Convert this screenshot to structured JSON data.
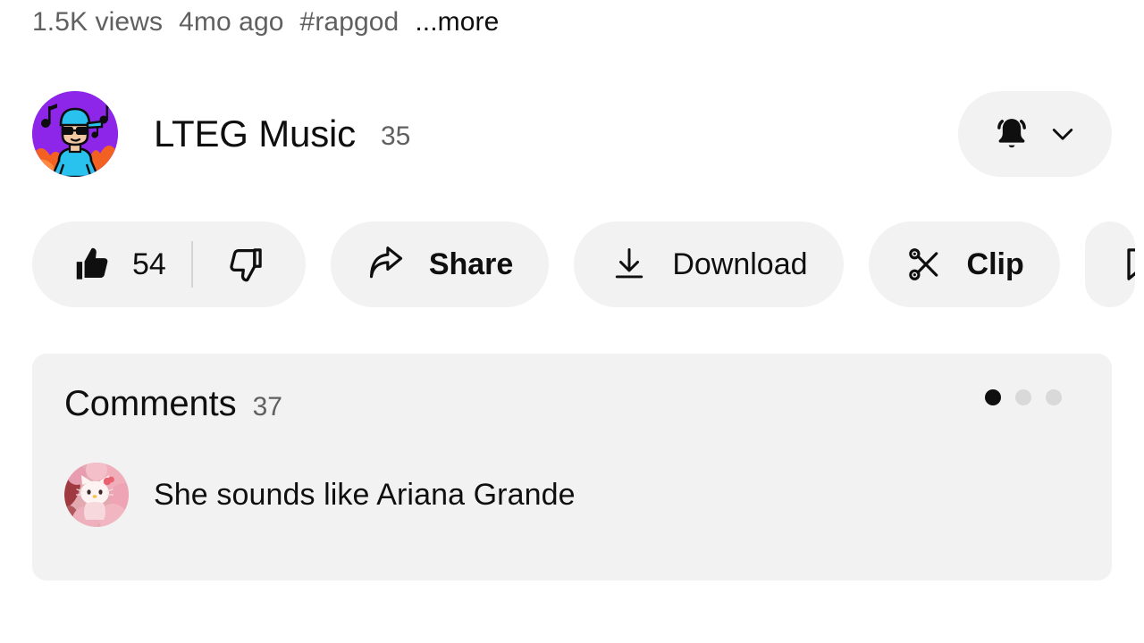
{
  "video_meta": {
    "views": "1.5K views",
    "published": "4mo ago",
    "hashtag": "#rapgod",
    "more_label": "...more"
  },
  "channel": {
    "name": "LTEG Music",
    "subscribers": "35",
    "avatar_icon": "music-producer-avatar",
    "notification_button": {
      "bell_icon": "bell-ringing-icon",
      "chevron_icon": "chevron-down-icon"
    }
  },
  "actions": {
    "like": {
      "icon": "thumbs-up-filled-icon",
      "count": "54"
    },
    "dislike": {
      "icon": "thumbs-down-outline-icon"
    },
    "share": {
      "icon": "share-arrow-icon",
      "label": "Share"
    },
    "download": {
      "icon": "download-arrow-icon",
      "label": "Download"
    },
    "clip": {
      "icon": "scissors-icon",
      "label": "Clip"
    },
    "save": {
      "icon": "bookmark-flag-icon",
      "label": ""
    }
  },
  "comments": {
    "title": "Comments",
    "count": "37",
    "pagination": {
      "total": 3,
      "active_index": 0
    },
    "items": [
      {
        "avatar_icon": "hello-kitty-avatar",
        "text": "She sounds like Ariana Grande"
      }
    ]
  },
  "colors": {
    "page_background": "#ffffff",
    "pill_background": "#f2f2f2",
    "panel_background": "#f2f2f2",
    "primary_text": "#0f0f0f",
    "secondary_text": "#606060",
    "avatar_purple": "#8d26e8",
    "avatar_orange": "#f26122",
    "avatar_cap_blue": "#29c1ee",
    "dot_inactive": "#d9d9d9"
  }
}
